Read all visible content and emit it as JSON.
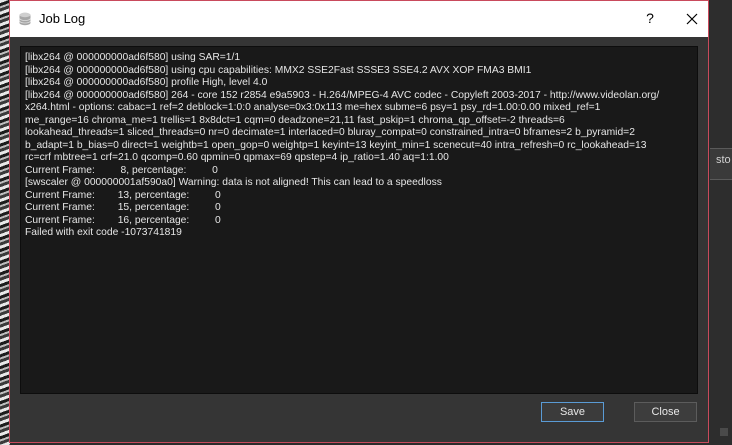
{
  "window": {
    "title": "Job Log",
    "help_label": "?",
    "close_icon": "close-icon",
    "app_icon": "database-icon"
  },
  "log_lines": [
    "[libx264 @ 000000000ad6f580] using SAR=1/1",
    "[libx264 @ 000000000ad6f580] using cpu capabilities: MMX2 SSE2Fast SSSE3 SSE4.2 AVX XOP FMA3 BMI1",
    "[libx264 @ 000000000ad6f580] profile High, level 4.0",
    "[libx264 @ 000000000ad6f580] 264 - core 152 r2854 e9a5903 - H.264/MPEG-4 AVC codec - Copyleft 2003-2017 - http://www.videolan.org/",
    "x264.html - options: cabac=1 ref=2 deblock=1:0:0 analyse=0x3:0x113 me=hex subme=6 psy=1 psy_rd=1.00:0.00 mixed_ref=1",
    "me_range=16 chroma_me=1 trellis=1 8x8dct=1 cqm=0 deadzone=21,11 fast_pskip=1 chroma_qp_offset=-2 threads=6",
    "lookahead_threads=1 sliced_threads=0 nr=0 decimate=1 interlaced=0 bluray_compat=0 constrained_intra=0 bframes=2 b_pyramid=2",
    "b_adapt=1 b_bias=0 direct=1 weightb=1 open_gop=0 weightp=1 keyint=13 keyint_min=1 scenecut=40 intra_refresh=0 rc_lookahead=13",
    "rc=crf mbtree=1 crf=21.0 qcomp=0.60 qpmin=0 qpmax=69 qpstep=4 ip_ratio=1.40 aq=1:1.00",
    "Current Frame:         8, percentage:         0",
    "[swscaler @ 000000001af590a0] Warning: data is not aligned! This can lead to a speedloss",
    "Current Frame:        13, percentage:         0",
    "Current Frame:        15, percentage:         0",
    "Current Frame:        16, percentage:         0",
    "Failed with exit code -1073741819"
  ],
  "buttons": {
    "save_label": "Save",
    "close_label": "Close"
  },
  "background": {
    "right_fragment_text": "sto"
  },
  "colors": {
    "dialog_border": "#c94a5c",
    "save_focus_border": "#5a9bd5",
    "log_background": "#191919"
  }
}
